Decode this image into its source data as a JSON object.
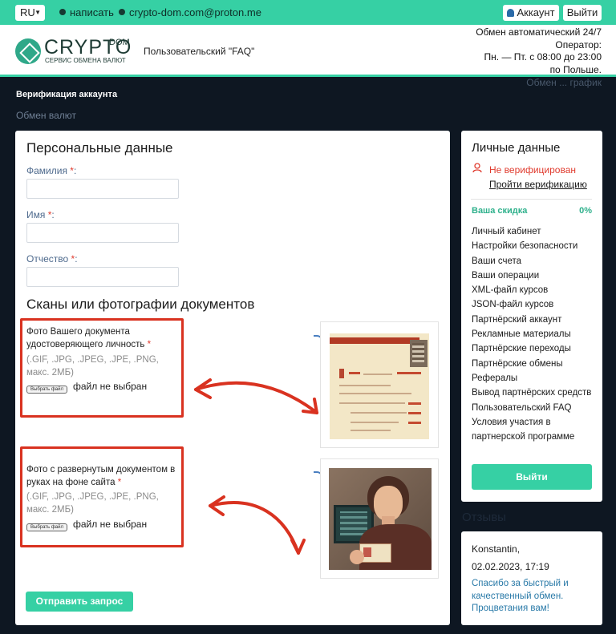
{
  "topbar": {
    "lang": "RU",
    "write_link": "написать",
    "email_link": "crypto-dom.com@proton.me",
    "account_btn": "Аккаунт",
    "logout_btn": "Выйти"
  },
  "header": {
    "logo_main": "CRYPTO",
    "logo_sup": "DOM",
    "logo_sub": "СЕРВИС ОБМЕНА ВАЛЮТ",
    "faq_link": "Пользовательский \"FAQ\"",
    "info_lines": [
      "Обмен автоматический 24/7",
      "Оператор:",
      "Пн. — Пт. с 08:00 до 23:00",
      "по Польше."
    ],
    "info_cut": "Обмен ... график"
  },
  "breadcrumb": {
    "title": "Верификация аккаунта",
    "link": "Обмен валют"
  },
  "form": {
    "personal_title": "Персональные данные",
    "surname_label": "Фамилия",
    "name_label": "Имя",
    "patronymic_label": "Отчество",
    "req_mark": "*",
    "colon": ":",
    "scans_title": "Сканы или фотографии документов",
    "doc1_title": "Фото Вашего документа удостоверяющего личность",
    "doc2_title": "Фото с развернутым документом в руках на фоне сайта",
    "doc_formats": "(.GIF, .JPG, .JPEG, .JPE, .PNG, макс. 2МБ)",
    "choose_file": "Выбрать файл",
    "no_file": "файл не выбран",
    "submit": "Отправить запрос"
  },
  "sidebar": {
    "title": "Личные данные",
    "not_verified": "Не верифицирован",
    "go_verify": "Пройти верификацию",
    "discount_label": "Ваша скидка",
    "discount_value": "0%",
    "menu": [
      "Личный кабинет",
      "Настройки безопасности",
      "Ваши счета",
      "Ваши операции",
      "XML-файл курсов",
      "JSON-файл курсов",
      "Партнёрский аккаунт",
      "Рекламные материалы",
      "Партнёрские переходы",
      "Партнёрские обмены",
      "Рефералы",
      "Вывод партнёрских средств",
      "Пользовательский FAQ",
      "Условия участия в партнерской программе"
    ],
    "logout": "Выйти"
  },
  "reviews": {
    "title": "Отзывы",
    "name": "Konstantin,",
    "date": "02.02.2023, 17:19",
    "text": "Спасибо за быстрый и качественный обмен. Процветания вам!"
  },
  "colors": {
    "accent": "#36d0a4",
    "annotation_red": "#d93220",
    "page_bg": "#0e1722"
  }
}
